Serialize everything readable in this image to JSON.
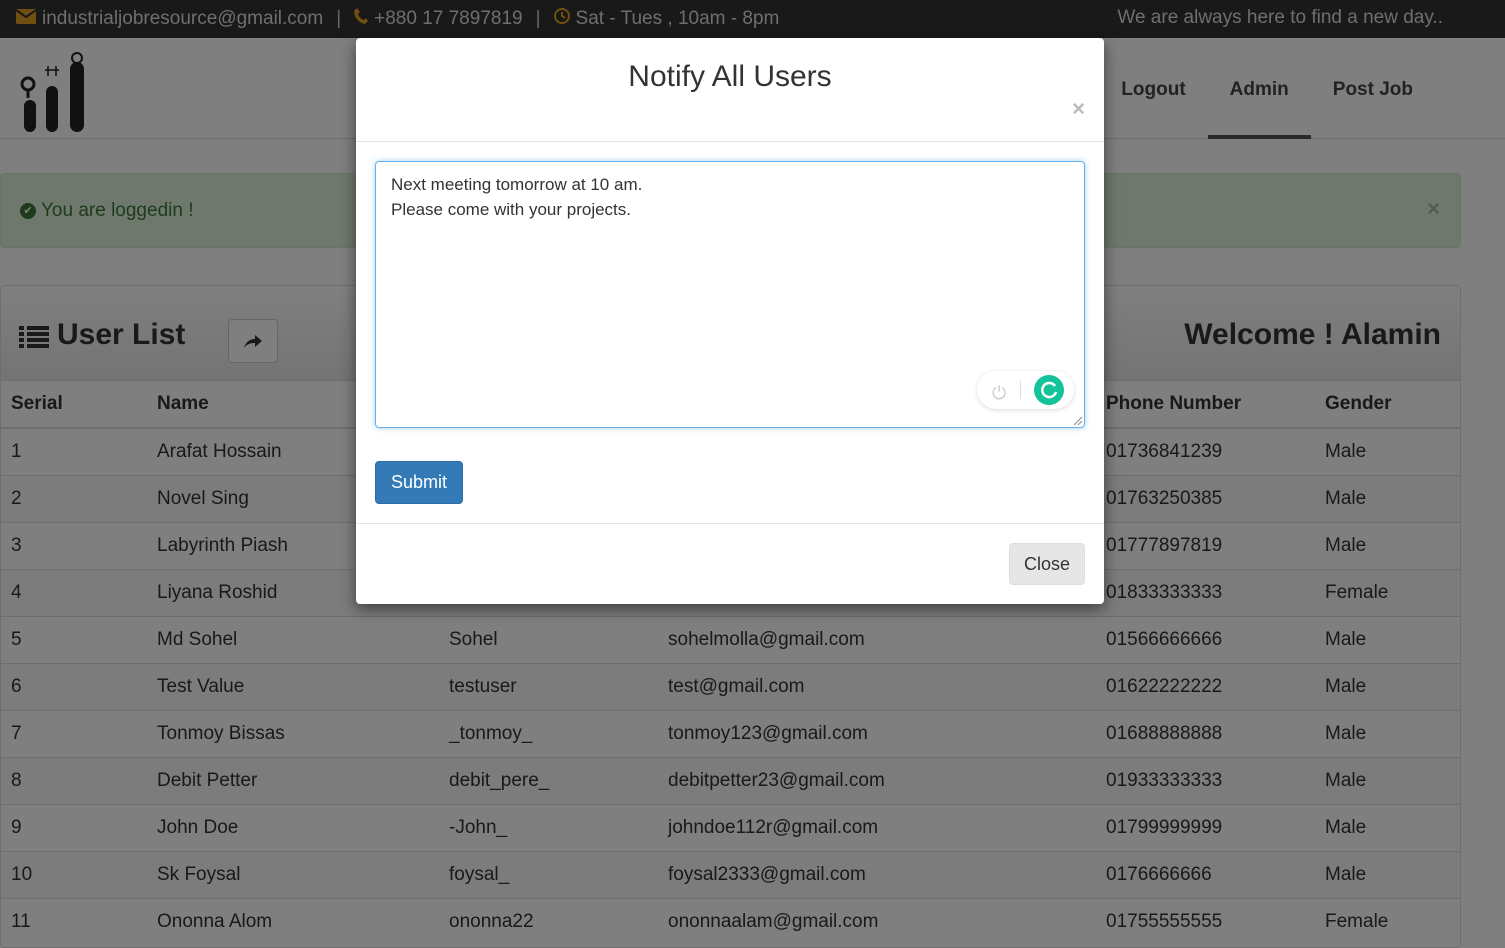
{
  "topbar": {
    "email": "industrialjobresource@gmail.com",
    "phone": "+880 17 7897819",
    "hours": "Sat - Tues , 10am - 8pm",
    "separator": "|",
    "tagline": "We are always here to find a new day.."
  },
  "nav": {
    "items": [
      {
        "label": "Logout"
      },
      {
        "label": "Admin"
      },
      {
        "label": "Post Job"
      }
    ]
  },
  "alert": {
    "message": "You are loggedin !",
    "close": "×"
  },
  "panel": {
    "title": "User List",
    "welcome": "Welcome ! Alamin"
  },
  "table": {
    "headers": [
      "Serial",
      "Name",
      "",
      "",
      "Phone Number",
      "Gender"
    ],
    "rows": [
      [
        "1",
        "Arafat Hossain",
        "",
        "",
        "01736841239",
        "Male"
      ],
      [
        "2",
        "Novel Sing",
        "",
        "",
        "01763250385",
        "Male"
      ],
      [
        "3",
        "Labyrinth Piash",
        "",
        "",
        "01777897819",
        "Male"
      ],
      [
        "4",
        "Liyana Roshid",
        "",
        "",
        "01833333333",
        "Female"
      ],
      [
        "5",
        "Md Sohel",
        "Sohel",
        "sohelmolla@gmail.com",
        "01566666666",
        "Male"
      ],
      [
        "6",
        "Test Value",
        "testuser",
        "test@gmail.com",
        "01622222222",
        "Male"
      ],
      [
        "7",
        "Tonmoy Bissas",
        "_tonmoy_",
        "tonmoy123@gmail.com",
        "01688888888",
        "Male"
      ],
      [
        "8",
        "Debit Petter",
        "debit_pere_",
        "debitpetter23@gmail.com",
        "01933333333",
        "Male"
      ],
      [
        "9",
        "John Doe",
        "-John_",
        "johndoe112r@gmail.com",
        "01799999999",
        "Male"
      ],
      [
        "10",
        "Sk Foysal",
        "foysal_",
        "foysal2333@gmail.com",
        "0176666666",
        "Male"
      ],
      [
        "11",
        "Ononna Alom",
        "ononna22",
        "ononnaalam@gmail.com",
        "01755555555",
        "Female"
      ]
    ]
  },
  "modal": {
    "title": "Notify All Users",
    "close_x": "×",
    "message_line1": "Next meeting tomorrow at 10 am.",
    "message_line2": "Please come with your projects.",
    "submit_label": "Submit",
    "close_label": "Close"
  },
  "icons": {
    "email": "envelope-icon",
    "phone": "phone-icon",
    "clock": "clock-icon",
    "success": "check-circle-icon",
    "list": "list-icon",
    "share": "share-icon"
  },
  "colors": {
    "primary": "#337ab7",
    "alert_bg": "#dff0d8",
    "alert_text": "#3c763d",
    "topbar_bg": "#333333",
    "grammarly": "#15c39a"
  }
}
